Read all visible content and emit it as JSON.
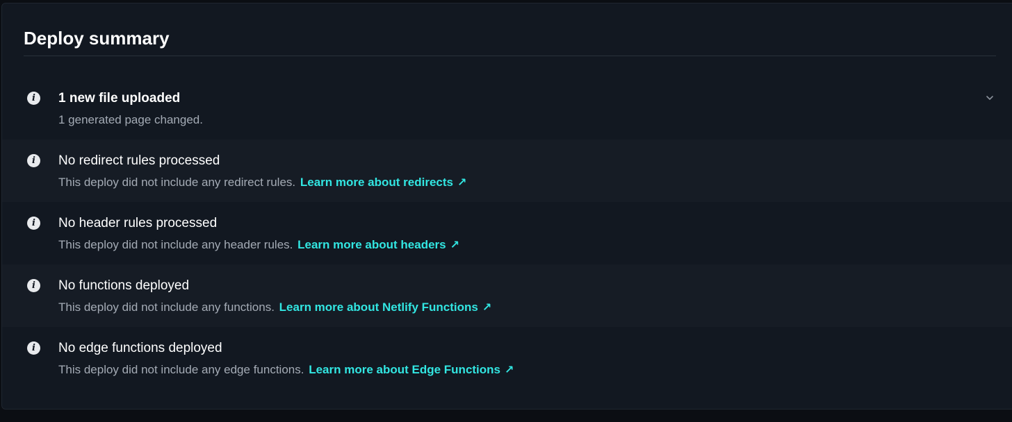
{
  "summary": {
    "title": "Deploy summary",
    "rows": [
      {
        "title": "1 new file uploaded",
        "description": "1 generated page changed.",
        "link": "",
        "expandable": true
      },
      {
        "title": "No redirect rules processed",
        "description": "This deploy did not include any redirect rules.",
        "link": "Learn more about redirects"
      },
      {
        "title": "No header rules processed",
        "description": "This deploy did not include any header rules.",
        "link": "Learn more about headers"
      },
      {
        "title": "No functions deployed",
        "description": "This deploy did not include any functions.",
        "link": "Learn more about Netlify Functions"
      },
      {
        "title": "No edge functions deployed",
        "description": "This deploy did not include any edge functions.",
        "link": "Learn more about Edge Functions"
      }
    ],
    "info_icon_glyph": "i",
    "external_link_glyph": "↗",
    "icons": {
      "info": "info-icon",
      "external": "external-link-icon",
      "expand": "chevron-down-icon"
    },
    "colors": {
      "background": "#121821",
      "row_alt": "#161c25",
      "link": "#32e6e2",
      "title": "#ffffff",
      "description": "#a4abb5"
    }
  }
}
